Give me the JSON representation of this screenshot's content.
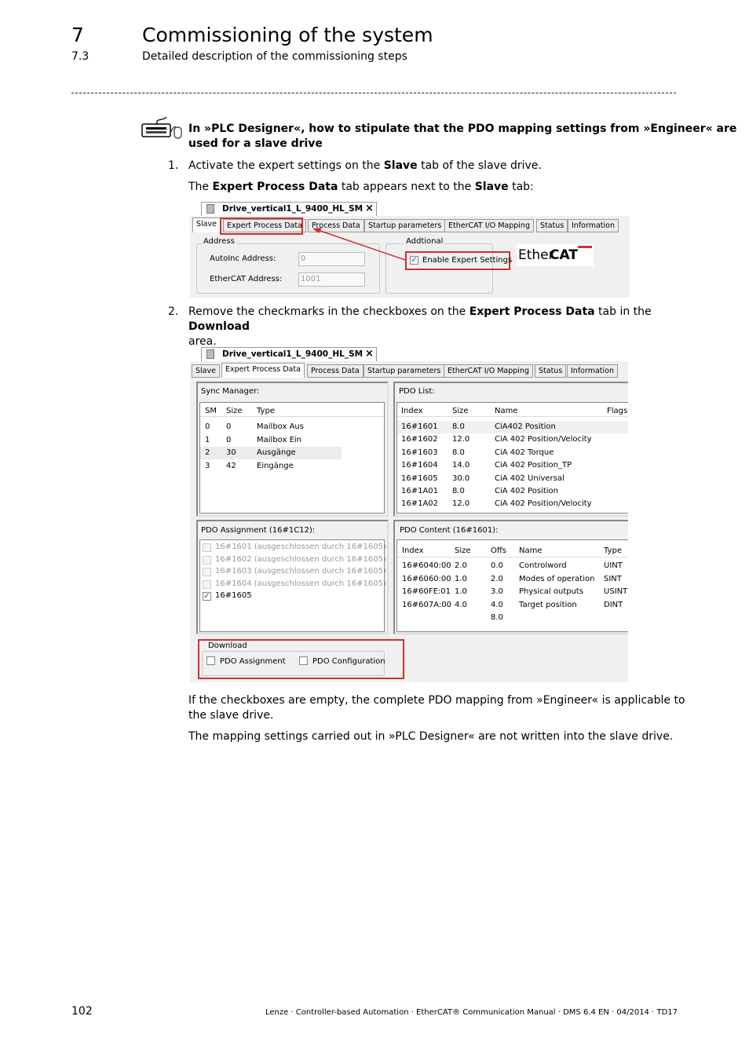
{
  "header": {
    "chapter": "7",
    "title": "Commissioning of the system",
    "section": "7.3",
    "subtitle": "Detailed description of the commissioning steps"
  },
  "note": {
    "icon": "keyboard-mouse-icon",
    "line1": "In »PLC Designer«, how to stipulate that the PDO mapping settings from »Engineer« are",
    "line2": "used for a slave drive"
  },
  "steps": [
    {
      "num": "1.",
      "parts": [
        "Activate the expert settings on the ",
        "Slave",
        " tab of the slave drive."
      ],
      "result": [
        "The ",
        "Expert Process Data",
        " tab appears next to the ",
        "Slave",
        " tab:"
      ]
    },
    {
      "num": "2.",
      "parts": [
        "Remove the checkmarks in the checkboxes on the ",
        "Expert Process Data",
        " tab in the ",
        "Download"
      ],
      "line2": "area."
    }
  ],
  "screenshot1": {
    "doc_tab": "Drive_vertical1_L_9400_HL_SM",
    "close": "×",
    "tabs": [
      "Slave",
      "Expert Process Data",
      "Process Data",
      "Startup parameters",
      "EtherCAT I/O Mapping",
      "Status",
      "Information"
    ],
    "address": {
      "legend": "Address",
      "autoinc_label": "AutoInc Address:",
      "autoinc_value": "0",
      "ethercat_label": "EtherCAT Address:",
      "ethercat_value": "1001"
    },
    "additional": {
      "legend": "Addtional",
      "checkbox": "Enable Expert Settings",
      "checked": true
    },
    "logo": {
      "a": "Ether",
      "b": "CAT"
    },
    "highlight_color": "#d03030"
  },
  "screenshot2": {
    "doc_tab": "Drive_vertical1_L_9400_HL_SM",
    "close": "×",
    "tabs": [
      "Slave",
      "Expert Process Data",
      "Process Data",
      "Startup parameters",
      "EtherCAT I/O Mapping",
      "Status",
      "Information"
    ],
    "sync": {
      "title": "Sync Manager:",
      "cols": [
        "SM",
        "Size",
        "Type"
      ],
      "rows": [
        [
          "0",
          "0",
          "Mailbox Aus"
        ],
        [
          "1",
          "0",
          "Mailbox Ein"
        ],
        [
          "2",
          "30",
          "Ausgänge"
        ],
        [
          "3",
          "42",
          "Eingänge"
        ]
      ]
    },
    "pdolist": {
      "title": "PDO List:",
      "cols": [
        "Index",
        "Size",
        "Name",
        "Flags"
      ],
      "rows": [
        [
          "16#1601",
          "8.0",
          "CiA402 Position"
        ],
        [
          "16#1602",
          "12.0",
          "CiA 402 Position/Velocity"
        ],
        [
          "16#1603",
          "8.0",
          "CiA 402 Torque"
        ],
        [
          "16#1604",
          "14.0",
          "CiA 402 Position_TP"
        ],
        [
          "16#1605",
          "30.0",
          "CiA 402 Universal"
        ],
        [
          "16#1A01",
          "8.0",
          "CiA 402 Position"
        ],
        [
          "16#1A02",
          "12.0",
          "CiA 402 Position/Velocity"
        ]
      ]
    },
    "assign": {
      "title": "PDO Assignment (16#1C12):",
      "items": [
        {
          "label": "16#1601 (ausgeschlossen durch 16#1605)",
          "checked": false,
          "disabled": true
        },
        {
          "label": "16#1602 (ausgeschlossen durch 16#1605)",
          "checked": false,
          "disabled": true
        },
        {
          "label": "16#1603 (ausgeschlossen durch 16#1605)",
          "checked": false,
          "disabled": true
        },
        {
          "label": "16#1604 (ausgeschlossen durch 16#1605)",
          "checked": false,
          "disabled": true
        },
        {
          "label": "16#1605",
          "checked": true,
          "disabled": false
        }
      ]
    },
    "content": {
      "title": "PDO Content (16#1601):",
      "cols": [
        "Index",
        "Size",
        "Offs",
        "Name",
        "Type"
      ],
      "rows": [
        [
          "16#6040:00",
          "2.0",
          "0.0",
          "Controlword",
          "UINT"
        ],
        [
          "16#6060:00",
          "1.0",
          "2.0",
          "Modes of operation",
          "SINT"
        ],
        [
          "16#60FE:01",
          "1.0",
          "3.0",
          "Physical outputs",
          "USINT"
        ],
        [
          "16#607A:00",
          "4.0",
          "4.0",
          "Target position",
          "DINT"
        ],
        [
          "",
          "",
          "8.0",
          "",
          ""
        ]
      ]
    },
    "download": {
      "legend": "Download",
      "a": "PDO Assignment",
      "b": "PDO Configuration",
      "a_checked": false,
      "b_checked": false
    }
  },
  "after": {
    "p1a": "If the checkboxes are empty, the complete PDO mapping from »Engineer« is applicable to",
    "p1b": "the slave drive.",
    "p2": "The mapping settings carried out in »PLC Designer« are not written into the slave drive."
  },
  "footer": {
    "page": "102",
    "text": "Lenze · Controller-based Automation · EtherCAT® Communication Manual · DMS 6.4 EN · 04/2014 · TD17"
  }
}
